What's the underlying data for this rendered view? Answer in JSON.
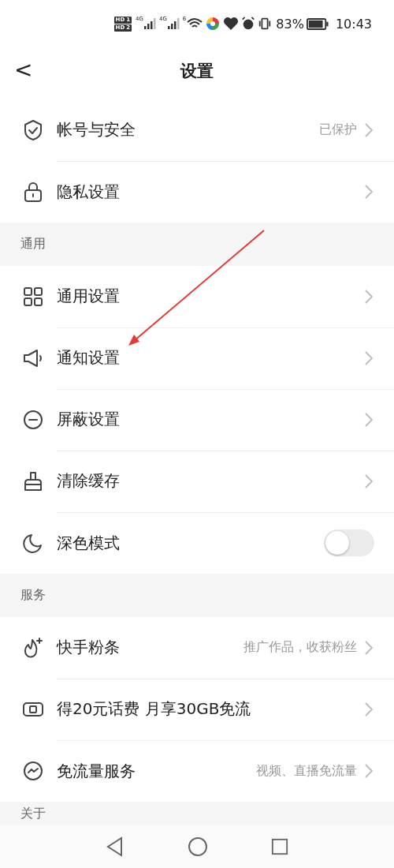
{
  "status_bar": {
    "hd_badges": [
      {
        "label": "HD",
        "sim": "1"
      },
      {
        "label": "HD",
        "sim": "2"
      }
    ],
    "networks": [
      "4G",
      "4G"
    ],
    "wifi": "6",
    "battery": "83%",
    "time": "10:43"
  },
  "header": {
    "back": "<",
    "title": "设置"
  },
  "sections": [
    {
      "items": [
        {
          "kind": "link",
          "label": "帐号与安全",
          "value": "已保护"
        },
        {
          "kind": "link",
          "label": "隐私设置"
        }
      ]
    },
    {
      "title": "通用",
      "items": [
        {
          "kind": "link",
          "label": "通用设置"
        },
        {
          "kind": "link",
          "label": "通知设置"
        },
        {
          "kind": "link",
          "label": "屏蔽设置"
        },
        {
          "kind": "link",
          "label": "清除缓存"
        },
        {
          "kind": "toggle",
          "label": "深色模式",
          "on": false
        }
      ]
    },
    {
      "title": "服务",
      "items": [
        {
          "kind": "link",
          "label": "快手粉条",
          "value": "推广作品，收获粉丝"
        },
        {
          "kind": "link",
          "label": "得20元话费 月享30GB免流"
        },
        {
          "kind": "link",
          "label": "免流量服务",
          "value": "视频、直播免流量"
        }
      ]
    },
    {
      "title": "关于"
    }
  ]
}
